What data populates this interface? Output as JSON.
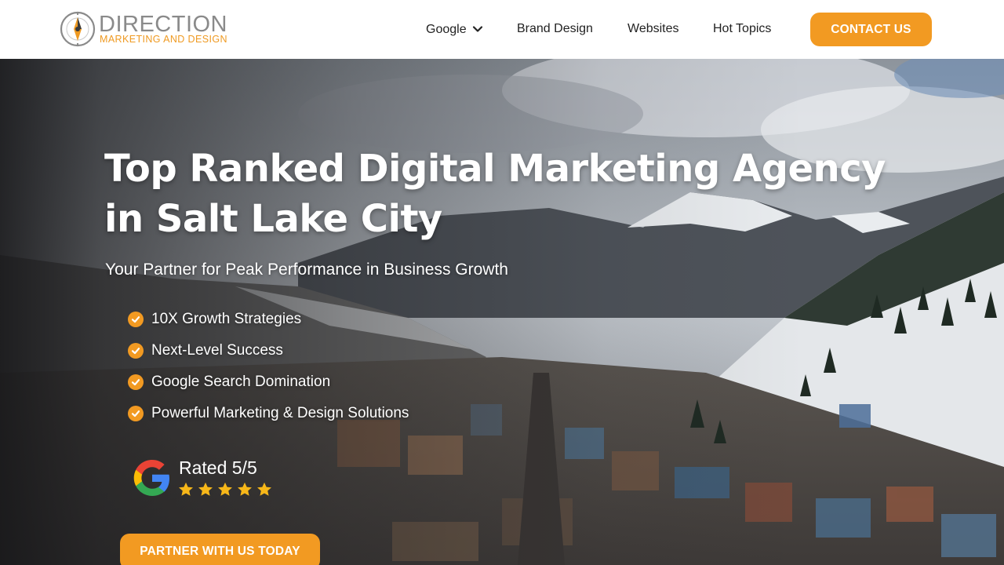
{
  "brand": {
    "name": "DIRECTION",
    "tagline": "MARKETING AND DESIGN"
  },
  "nav": {
    "items": [
      {
        "label": "Google",
        "has_dropdown": true
      },
      {
        "label": "Brand Design"
      },
      {
        "label": "Websites"
      },
      {
        "label": "Hot Topics"
      }
    ],
    "cta_label": "CONTACT US"
  },
  "hero": {
    "title_line1": "Top Ranked Digital Marketing Agency",
    "title_line2": "in Salt Lake City",
    "subtitle": "Your Partner for Peak Performance in Business Growth",
    "bullets": [
      "10X Growth Strategies",
      "Next-Level Success",
      "Google Search Domination",
      "Powerful Marketing & Design Solutions"
    ],
    "rating": {
      "text": "Rated 5/5",
      "stars": 5,
      "stars_max": 5
    },
    "cta_label": "PARTNER WITH US TODAY"
  },
  "colors": {
    "accent": "#f29a22",
    "text_dark": "#222222",
    "logo_gray": "#8a8a8a"
  }
}
